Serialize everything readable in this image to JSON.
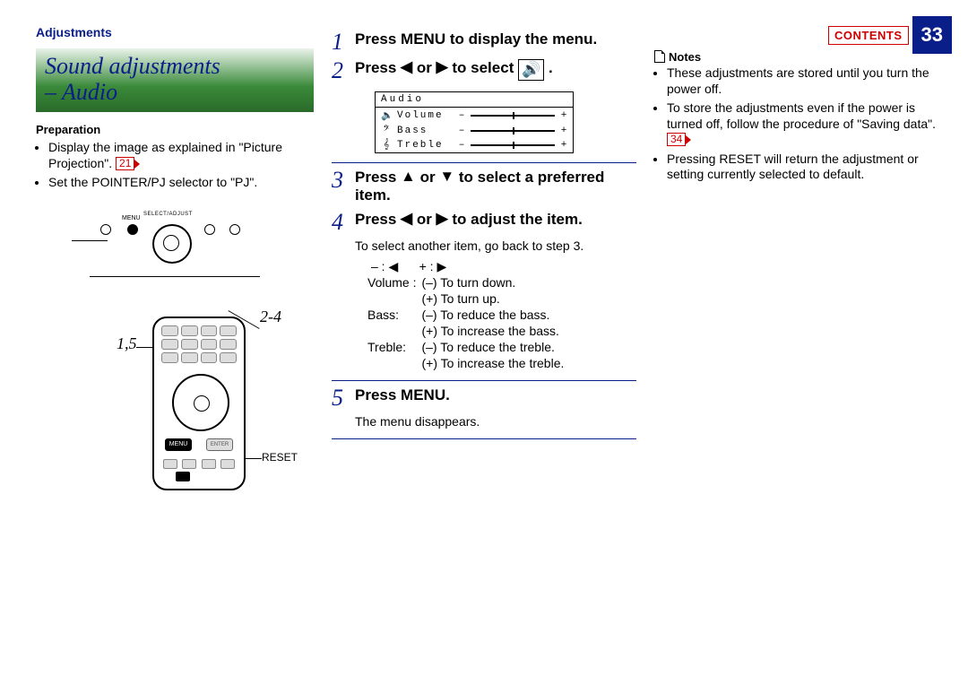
{
  "header": {
    "section": "Adjustments",
    "contents_label": "CONTENTS",
    "page_number": "33"
  },
  "title": {
    "line1": "Sound adjustments",
    "line2": "– Audio"
  },
  "preparation": {
    "heading": "Preparation",
    "items": [
      "Display the image as explained in \"Picture Projection\".",
      "Set the POINTER/PJ selector to \"PJ\"."
    ],
    "ref1": "21"
  },
  "diagram": {
    "panel_select_adjust": "SELECT/ADJUST",
    "panel_menu": "MENU",
    "callout_15": "1,5",
    "callout_24": "2-4",
    "remote_menu": "MENU",
    "remote_enter": "ENTER",
    "reset_label": "RESET"
  },
  "steps": {
    "s1": {
      "num": "1",
      "title": "Press MENU to display the menu."
    },
    "s2": {
      "num": "2",
      "title_pre": "Press ",
      "title_mid": " or ",
      "title_post": " to select ",
      "arrow_l": "◀",
      "arrow_r": "▶",
      "speaker": "🔊",
      "period": " ."
    },
    "osd": {
      "title": "Audio",
      "rows": [
        {
          "icon": "🔈",
          "label": "Volume"
        },
        {
          "icon": "𝄢",
          "label": "Bass"
        },
        {
          "icon": "𝄞",
          "label": "Treble"
        }
      ],
      "minus": "–",
      "plus": "+"
    },
    "s3": {
      "num": "3",
      "title_pre": "Press ",
      "arrow_u": "▲",
      "title_mid": " or ",
      "arrow_d": "▼",
      "title_post": " to select a preferred item."
    },
    "s4": {
      "num": "4",
      "title_pre": "Press ",
      "arrow_l": "◀",
      "title_mid": " or ",
      "arrow_r": "▶",
      "title_post": " to adjust the item."
    },
    "s4_note": "To select another item, go back to step 3.",
    "pm_line": {
      "minus": "– :",
      "left": "◀",
      "gap": "     ",
      "plus": "+ :",
      "right": "▶"
    },
    "table": [
      {
        "name": "Volume :",
        "m": "(–) To turn down.",
        "p": "(+) To turn up."
      },
      {
        "name": "Bass:",
        "m": "(–) To reduce the bass.",
        "p": "(+) To increase the bass."
      },
      {
        "name": "Treble:",
        "m": "(–) To reduce the treble.",
        "p": "(+) To increase the treble."
      }
    ],
    "s5": {
      "num": "5",
      "title": "Press MENU."
    },
    "s5_note": "The menu disappears."
  },
  "notes": {
    "heading": "Notes",
    "items": [
      "These adjustments are stored until you turn the power off.",
      "To store the adjustments even if the power is turned off, follow the procedure of \"Saving data\".",
      "Pressing RESET will return the adjustment or setting currently selected to default."
    ],
    "ref34": "34"
  }
}
